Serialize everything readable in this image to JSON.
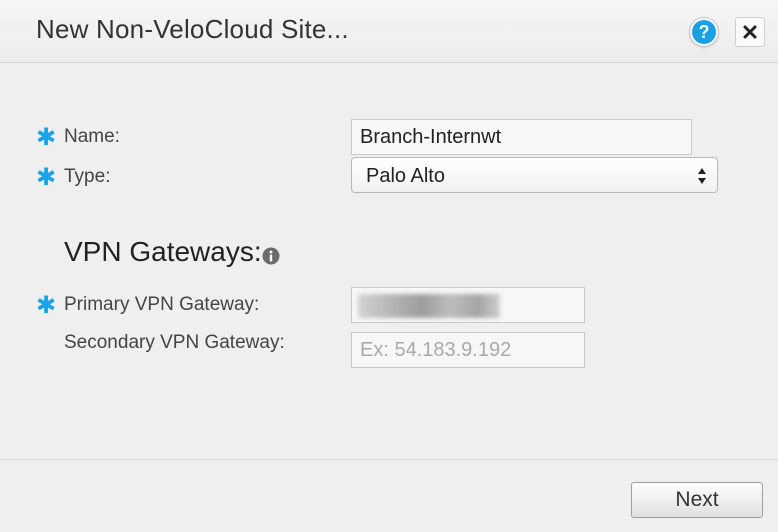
{
  "dialog": {
    "title": "New Non-VeloCloud Site...",
    "help_glyph": "?",
    "help_icon": "question-circle-icon",
    "close_icon": "close-x-icon"
  },
  "form": {
    "required_marker": "✱",
    "name": {
      "label": "Name:",
      "value": "Branch-Internwt"
    },
    "type": {
      "label": "Type:",
      "selected": "Palo Alto"
    }
  },
  "vpn": {
    "section_title": "VPN Gateways:",
    "info_icon": "info-circle-icon",
    "primary": {
      "label": "Primary VPN Gateway:"
    },
    "secondary": {
      "label": "Secondary VPN Gateway:",
      "placeholder": "Ex: 54.183.9.192",
      "value": ""
    }
  },
  "footer": {
    "next_label": "Next"
  },
  "colors": {
    "required": "#1aa3e8",
    "help": "#1ba1e2",
    "background": "#efefef"
  }
}
